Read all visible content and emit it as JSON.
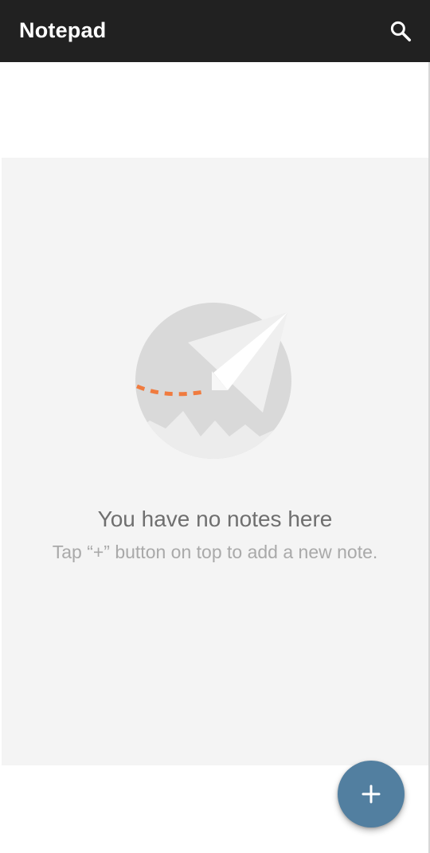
{
  "app_bar": {
    "title": "Notepad",
    "search_icon": "search-icon",
    "background": "#212121"
  },
  "empty_state": {
    "illustration": "paper-plane-icon",
    "title": "You have no notes here",
    "subtitle": "Tap “+” button on top to add a new note."
  },
  "fab": {
    "icon": "plus-icon",
    "color": "#527fa0"
  },
  "colors": {
    "accent_orange": "#f07b3f",
    "panel_background": "#f4f4f4"
  }
}
